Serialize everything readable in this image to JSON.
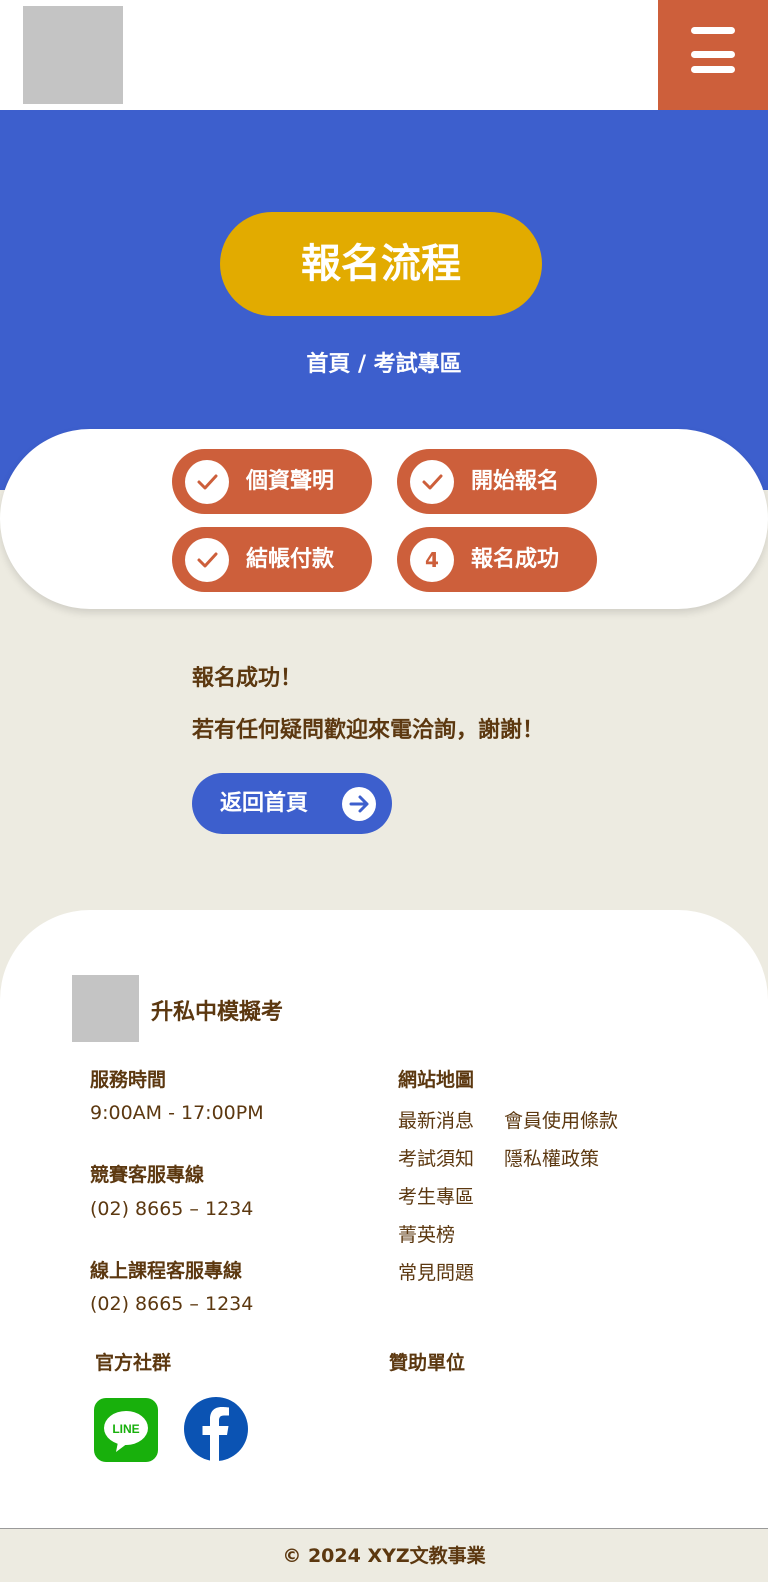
{
  "header": {
    "logo": "logo placeholder",
    "menu_icon": "hamburger-menu-icon"
  },
  "hero": {
    "title": "報名流程",
    "breadcrumb": "首頁 / 考試專區"
  },
  "steps": [
    {
      "badge": "",
      "label": "個資聲明",
      "status": "done",
      "icon": "check-icon"
    },
    {
      "badge": "",
      "label": "開始報名",
      "status": "done",
      "icon": "check-icon"
    },
    {
      "badge": "",
      "label": "結帳付款",
      "status": "done",
      "icon": "check-icon"
    },
    {
      "badge": "4",
      "label": "報名成功",
      "status": "current",
      "icon": ""
    }
  ],
  "result": {
    "title": "報名成功！",
    "message": "若有任何疑問歡迎來電洽詢，謝謝！",
    "home_button": "返回首頁"
  },
  "footer": {
    "brand": "升私中模擬考",
    "service_hours_label": "服務時間",
    "service_hours": "9:00AM - 17:00PM",
    "contest_line_label": "競賽客服專線",
    "contest_line": "(02) 8665 – 1234",
    "course_line_label": "線上課程客服專線",
    "course_line": "(02) 8665 – 1234",
    "sitemap_label": "網站地圖",
    "sitemap_col1": [
      "最新消息",
      "考試須知",
      "考生專區",
      "菁英榜",
      "常見問題"
    ],
    "sitemap_col2": [
      "會員使用條款",
      "隱私權政策"
    ],
    "social_label": "官方社群",
    "sponsor_label": "贊助單位",
    "social": [
      {
        "name": "LINE",
        "icon": "line-icon"
      },
      {
        "name": "Facebook",
        "icon": "facebook-icon"
      }
    ]
  },
  "copyright": "© 2024 XYZ文教事業",
  "colors": {
    "primary_blue": "#3d5fcd",
    "accent_orange": "#cd5f3b",
    "title_gold": "#e2ab00",
    "text_brown": "#5c3810",
    "page_beige": "#edebe1"
  }
}
